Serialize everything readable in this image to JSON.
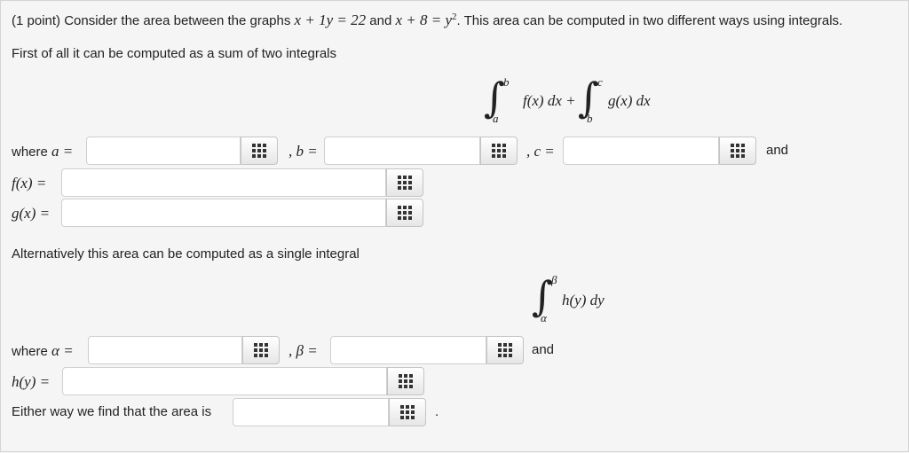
{
  "header": {
    "points": "(1 point)",
    "intro": " Consider the area between the graphs ",
    "eq1": "x + 1y = 22",
    "and_word": " and ",
    "eq2": "x + 8 = y",
    "eq2_exp": "2",
    "outro": ". This area can be computed in two different ways using integrals."
  },
  "part1": {
    "text": "First of all it can be computed as a sum of two integrals",
    "formula": {
      "int_symbol": "∫",
      "lower1": "a",
      "upper1": "b",
      "integrand1": "f(x) dx +",
      "lower2": "b",
      "upper2": "c",
      "integrand2": "g(x) dx"
    },
    "where_label": "where ",
    "a_label": "a =",
    "b_label": ", b =",
    "c_label": ", c =",
    "and_label": "and",
    "f_label": "f(x) =",
    "g_label": "g(x) ="
  },
  "part2": {
    "text": "Alternatively this area can be computed as a single integral",
    "formula": {
      "int_symbol": "∫",
      "lower": "α",
      "upper": "β",
      "integrand": "h(y) dy"
    },
    "where_label": "where ",
    "alpha_label": "α =",
    "beta_label": ", β =",
    "and_label": "and",
    "h_label": "h(y) ="
  },
  "final": {
    "text": "Either way we find that the area is",
    "period": "."
  },
  "inputs": {
    "a": "",
    "b": "",
    "c": "",
    "f": "",
    "g": "",
    "alpha": "",
    "beta": "",
    "h": "",
    "area": ""
  },
  "icons": {
    "equation_editor": "grid-icon"
  }
}
